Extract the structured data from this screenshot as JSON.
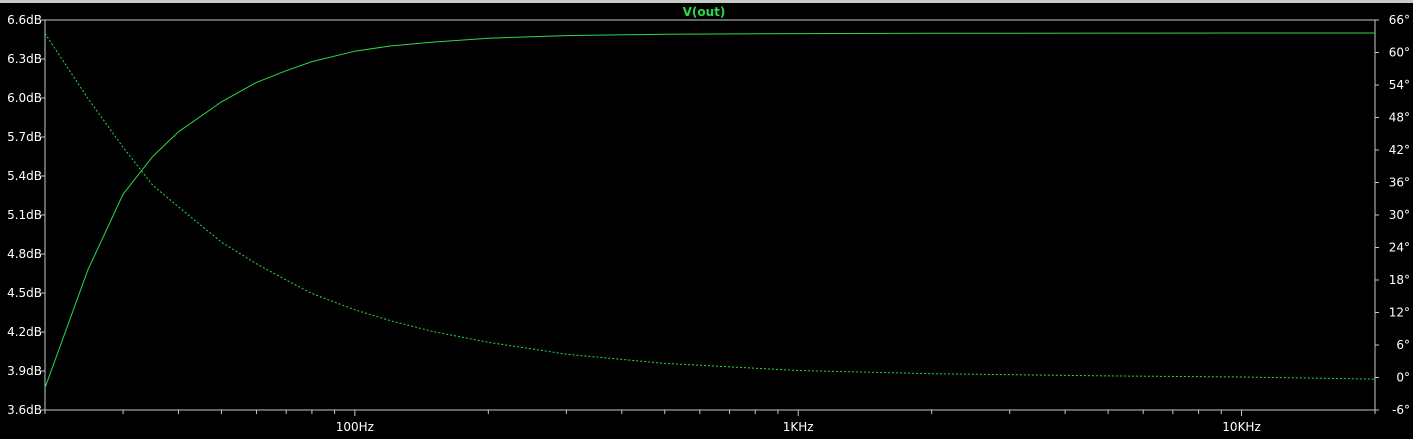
{
  "colors": {
    "background": "#000000",
    "axis": "#c8c8c8",
    "tick_text": "#ffffff",
    "trace": "#2ad94a",
    "title": "#2ad94a"
  },
  "chart_data": {
    "type": "line",
    "title": "V(out)",
    "x_scale": "log",
    "xlim": [
      20,
      20000
    ],
    "x_ticks": [
      {
        "value": 100,
        "label": "100Hz"
      },
      {
        "value": 1000,
        "label": "1KHz"
      },
      {
        "value": 10000,
        "label": "10KHz"
      }
    ],
    "y_left": {
      "unit": "dB",
      "ylim": [
        3.6,
        6.6
      ],
      "ticks": [
        {
          "value": 6.6,
          "label": "6.6dB"
        },
        {
          "value": 6.3,
          "label": "6.3dB"
        },
        {
          "value": 6.0,
          "label": "6.0dB"
        },
        {
          "value": 5.7,
          "label": "5.7dB"
        },
        {
          "value": 5.4,
          "label": "5.4dB"
        },
        {
          "value": 5.1,
          "label": "5.1dB"
        },
        {
          "value": 4.8,
          "label": "4.8dB"
        },
        {
          "value": 4.5,
          "label": "4.5dB"
        },
        {
          "value": 4.2,
          "label": "4.2dB"
        },
        {
          "value": 3.9,
          "label": "3.9dB"
        },
        {
          "value": 3.6,
          "label": "3.6dB"
        }
      ]
    },
    "y_right": {
      "unit": "°",
      "ylim": [
        -6,
        66
      ],
      "ticks": [
        {
          "value": 66,
          "label": "66°"
        },
        {
          "value": 60,
          "label": "60°"
        },
        {
          "value": 54,
          "label": "54°"
        },
        {
          "value": 48,
          "label": "48°"
        },
        {
          "value": 42,
          "label": "42°"
        },
        {
          "value": 36,
          "label": "36°"
        },
        {
          "value": 30,
          "label": "30°"
        },
        {
          "value": 24,
          "label": "24°"
        },
        {
          "value": 18,
          "label": "18°"
        },
        {
          "value": 12,
          "label": "12°"
        },
        {
          "value": 6,
          "label": "6°"
        },
        {
          "value": 0,
          "label": "0°"
        },
        {
          "value": -6,
          "label": "-6°"
        }
      ]
    },
    "series": [
      {
        "axis": "left",
        "style": "solid",
        "x": [
          20,
          25,
          30,
          35,
          40,
          50,
          60,
          70,
          80,
          100,
          120,
          150,
          200,
          300,
          500,
          1000,
          2000,
          5000,
          10000,
          20000
        ],
        "y": [
          3.77,
          4.68,
          5.26,
          5.55,
          5.74,
          5.97,
          6.12,
          6.21,
          6.28,
          6.36,
          6.4,
          6.43,
          6.46,
          6.48,
          6.49,
          6.495,
          6.498,
          6.499,
          6.5,
          6.5
        ]
      },
      {
        "axis": "right",
        "style": "dashed",
        "x": [
          20,
          25,
          30,
          35,
          40,
          50,
          60,
          70,
          80,
          100,
          120,
          150,
          200,
          300,
          500,
          1000,
          2000,
          5000,
          10000,
          20000
        ],
        "y": [
          63.5,
          51.5,
          42.5,
          35.5,
          31.5,
          25.0,
          21.0,
          18.0,
          15.5,
          12.5,
          10.5,
          8.5,
          6.5,
          4.3,
          2.6,
          1.3,
          0.7,
          0.3,
          0.1,
          -0.3
        ]
      }
    ]
  }
}
